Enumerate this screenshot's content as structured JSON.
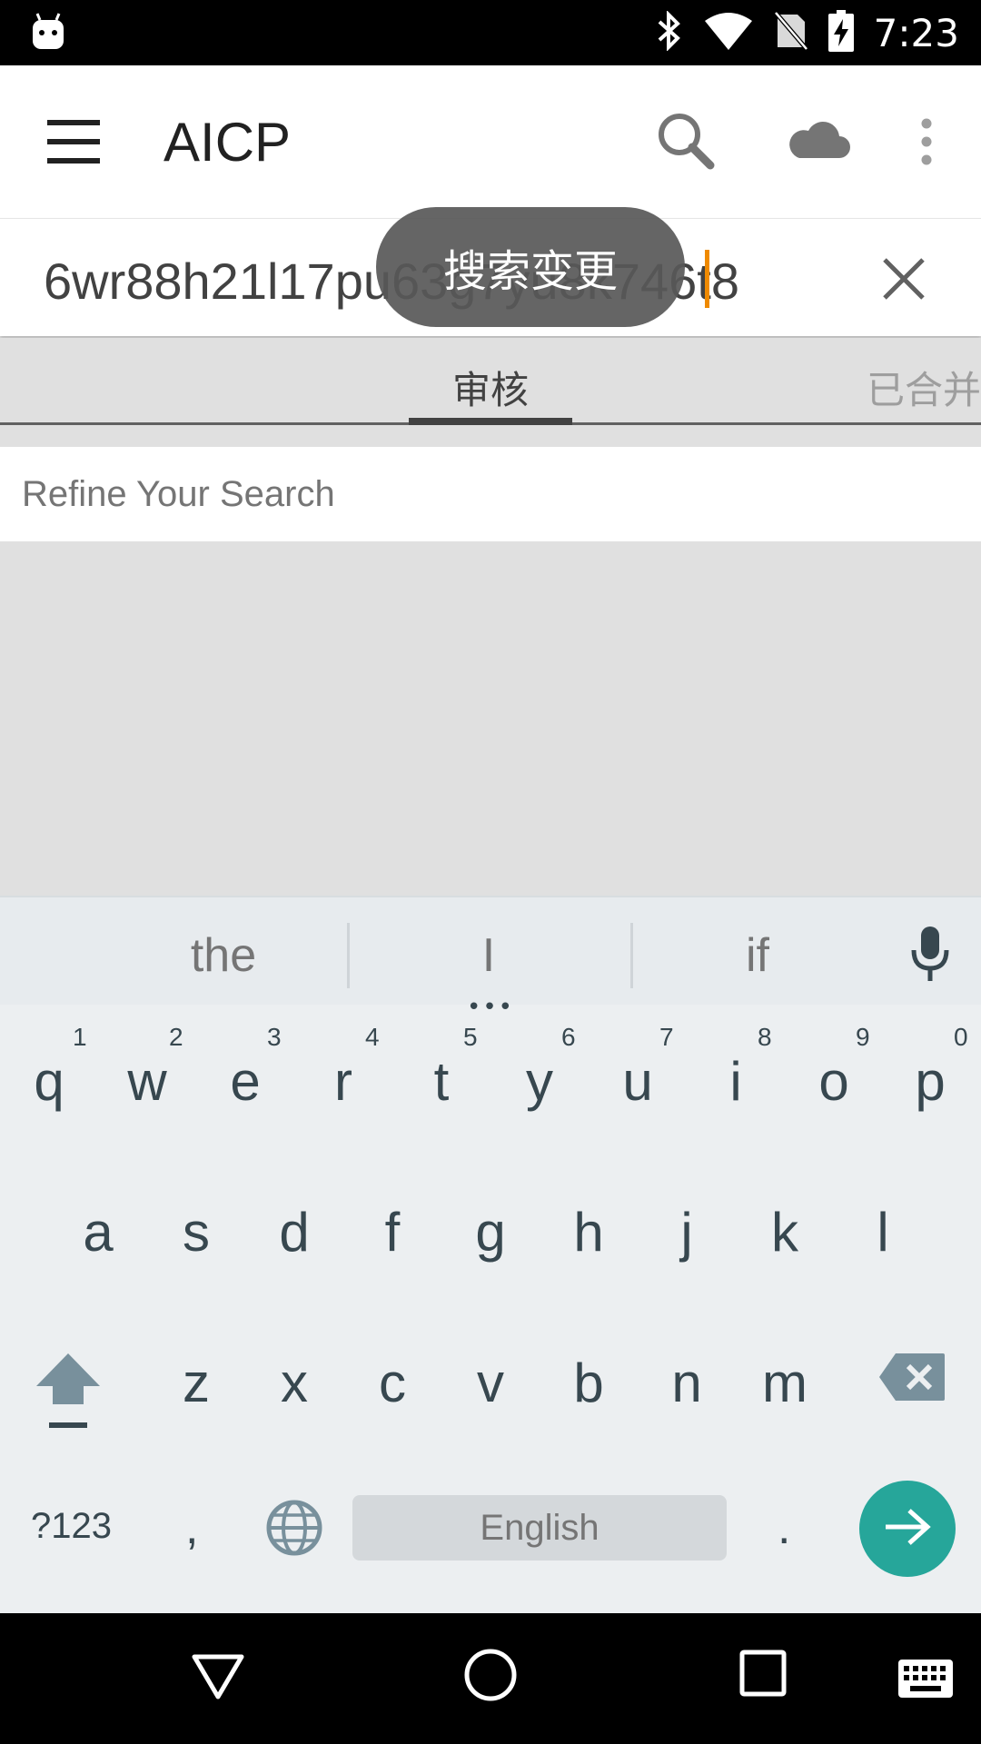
{
  "status_bar": {
    "time": "7:23",
    "icons": [
      "android-icon",
      "bluetooth-icon",
      "wifi-icon",
      "no-sim-icon",
      "battery-charging-icon"
    ]
  },
  "app_bar": {
    "title": "AICP",
    "actions": [
      "search-icon",
      "cloud-icon",
      "more-vert-icon"
    ]
  },
  "search": {
    "query": "6wr88h21l17pu63g7yu8k746t8",
    "clear_icon": "close-icon"
  },
  "toast": {
    "text": "搜索变更"
  },
  "tabs": [
    {
      "label": "审核",
      "selected": true
    },
    {
      "label": "已合并",
      "selected": false
    }
  ],
  "refine": {
    "placeholder": "Refine Your Search"
  },
  "keyboard": {
    "suggestions": [
      "the",
      "I",
      "if"
    ],
    "row1": [
      {
        "key": "q",
        "hint": "1"
      },
      {
        "key": "w",
        "hint": "2"
      },
      {
        "key": "e",
        "hint": "3"
      },
      {
        "key": "r",
        "hint": "4"
      },
      {
        "key": "t",
        "hint": "5"
      },
      {
        "key": "y",
        "hint": "6"
      },
      {
        "key": "u",
        "hint": "7"
      },
      {
        "key": "i",
        "hint": "8"
      },
      {
        "key": "o",
        "hint": "9"
      },
      {
        "key": "p",
        "hint": "0"
      }
    ],
    "row2": [
      "a",
      "s",
      "d",
      "f",
      "g",
      "h",
      "j",
      "k",
      "l"
    ],
    "row3": [
      "z",
      "x",
      "c",
      "v",
      "b",
      "n",
      "m"
    ],
    "symbols_label": "?123",
    "comma": ",",
    "space_label": "English",
    "period": ".",
    "accent_color": "#26a69a"
  },
  "nav_bar": [
    "back-icon",
    "home-icon",
    "recents-icon",
    "keyboard-icon"
  ]
}
